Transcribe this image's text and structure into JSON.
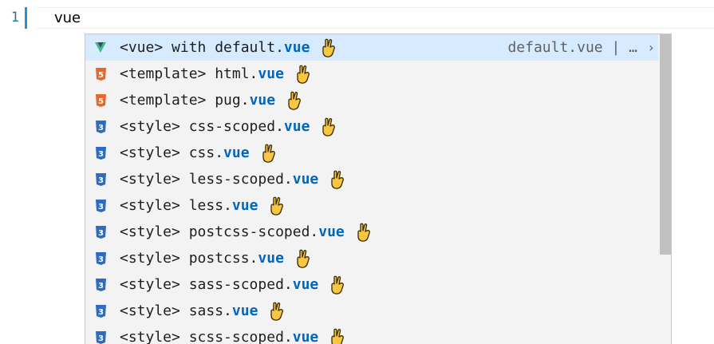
{
  "editor": {
    "line_number": "1",
    "text": "vue"
  },
  "suggestions": {
    "selected_detail": "default.vue | …",
    "readmore_glyph": "›",
    "items": [
      {
        "prefix": "<vue> with default.",
        "suffix": "vue",
        "icon": "vue-icon"
      },
      {
        "prefix": "<template> html.",
        "suffix": "vue",
        "icon": "html5-icon"
      },
      {
        "prefix": "<template> pug.",
        "suffix": "vue",
        "icon": "html5-icon"
      },
      {
        "prefix": "<style> css-scoped.",
        "suffix": "vue",
        "icon": "css3-icon"
      },
      {
        "prefix": "<style> css.",
        "suffix": "vue",
        "icon": "css3-icon"
      },
      {
        "prefix": "<style> less-scoped.",
        "suffix": "vue",
        "icon": "css3-icon"
      },
      {
        "prefix": "<style> less.",
        "suffix": "vue",
        "icon": "css3-icon"
      },
      {
        "prefix": "<style> postcss-scoped.",
        "suffix": "vue",
        "icon": "css3-icon"
      },
      {
        "prefix": "<style> postcss.",
        "suffix": "vue",
        "icon": "css3-icon"
      },
      {
        "prefix": "<style> sass-scoped.",
        "suffix": "vue",
        "icon": "css3-icon"
      },
      {
        "prefix": "<style> sass.",
        "suffix": "vue",
        "icon": "css3-icon"
      },
      {
        "prefix": "<style> scss-scoped.",
        "suffix": "vue",
        "icon": "css3-icon"
      }
    ]
  },
  "colors": {
    "vue_green": "#41b883",
    "html_orange": "#e5692b",
    "css_blue": "#2d6cc0",
    "highlight": "#0066bf",
    "selected_bg": "#d6ebff",
    "emoji_yellow": "#f7c744"
  }
}
